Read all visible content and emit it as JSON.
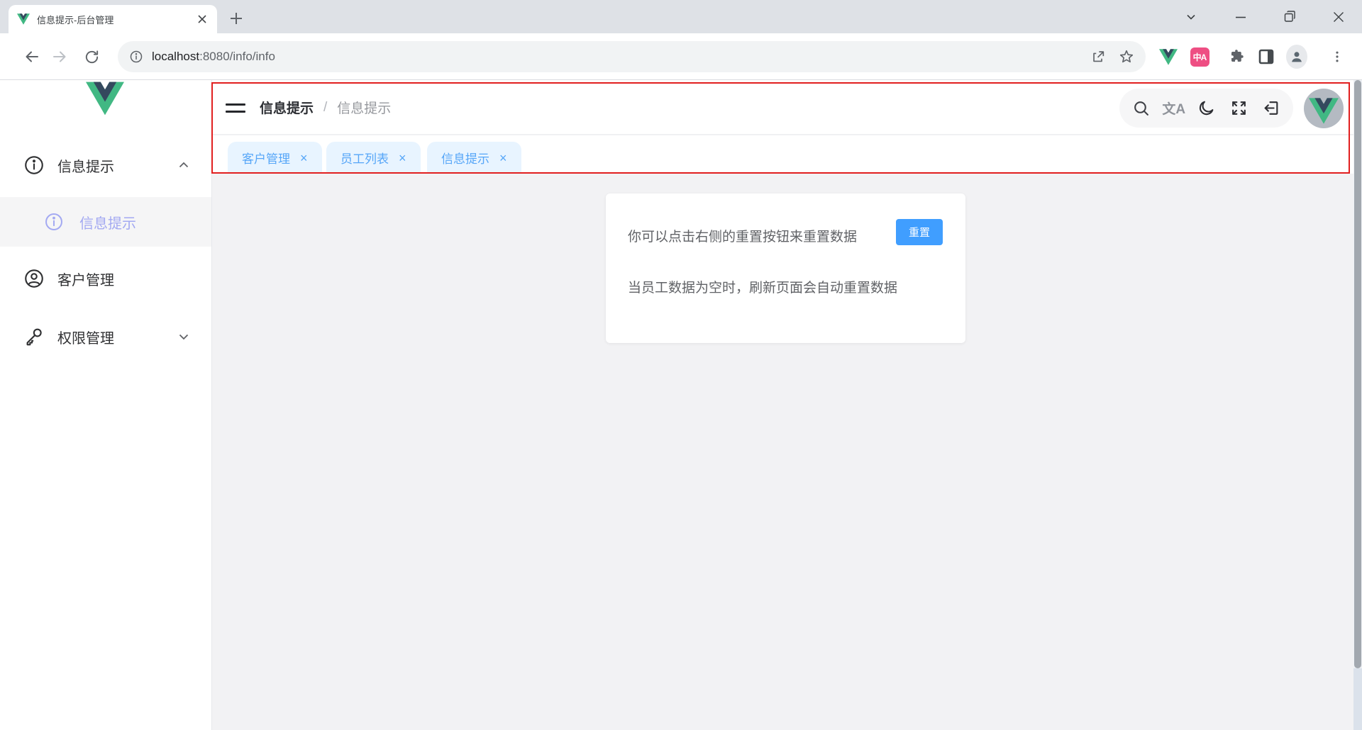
{
  "window": {
    "tab_title": "信息提示-后台管理",
    "url_host": "localhost",
    "url_path": ":8080/info/info",
    "icons": [
      "vue-favicon",
      "tab-close",
      "new-tab",
      "tab-search-chevron",
      "minimize",
      "restore",
      "close"
    ]
  },
  "toolbar": {
    "icons": [
      "back",
      "forward-disabled",
      "reload",
      "site-info",
      "share",
      "bookmark-star",
      "vue-devtools-extension",
      "translate-extension",
      "extensions-puzzle",
      "side-panel",
      "profile",
      "menu-dots"
    ],
    "translate_badge_text": "中A"
  },
  "sidebar": {
    "logo": "vue-logo",
    "menu": [
      {
        "label": "信息提示",
        "icon": "info-icon",
        "state": "expanded",
        "children": [
          {
            "label": "信息提示",
            "icon": "info-icon",
            "active": true
          }
        ]
      },
      {
        "label": "客户管理",
        "icon": "customer-icon"
      },
      {
        "label": "权限管理",
        "icon": "key-icon",
        "state": "collapsed"
      }
    ]
  },
  "header": {
    "breadcrumb": {
      "parent": "信息提示",
      "separator": "/",
      "current": "信息提示"
    },
    "action_icons": [
      "search",
      "translate",
      "dark-mode-moon",
      "fullscreen",
      "logout"
    ],
    "translate_glyph": "文A",
    "avatar": "vue-avatar"
  },
  "tags": [
    {
      "label": "客户管理",
      "close": "×"
    },
    {
      "label": "员工列表",
      "close": "×"
    },
    {
      "label": "信息提示",
      "close": "×"
    }
  ],
  "card": {
    "line1": "你可以点击右侧的重置按钮来重置数据",
    "reset_button": "重置",
    "line2": "当员工数据为空时，刷新页面会自动重置数据"
  },
  "colors": {
    "primary_blue": "#409eff",
    "tag_blue": "#56a6f8",
    "tag_bg": "#e8f4ff",
    "active_menu": "#a3a9f2",
    "debug_outline_red": "#e11f1f",
    "vue_green": "#41b883",
    "vue_dark": "#34495e",
    "content_bg": "#f2f2f4"
  }
}
